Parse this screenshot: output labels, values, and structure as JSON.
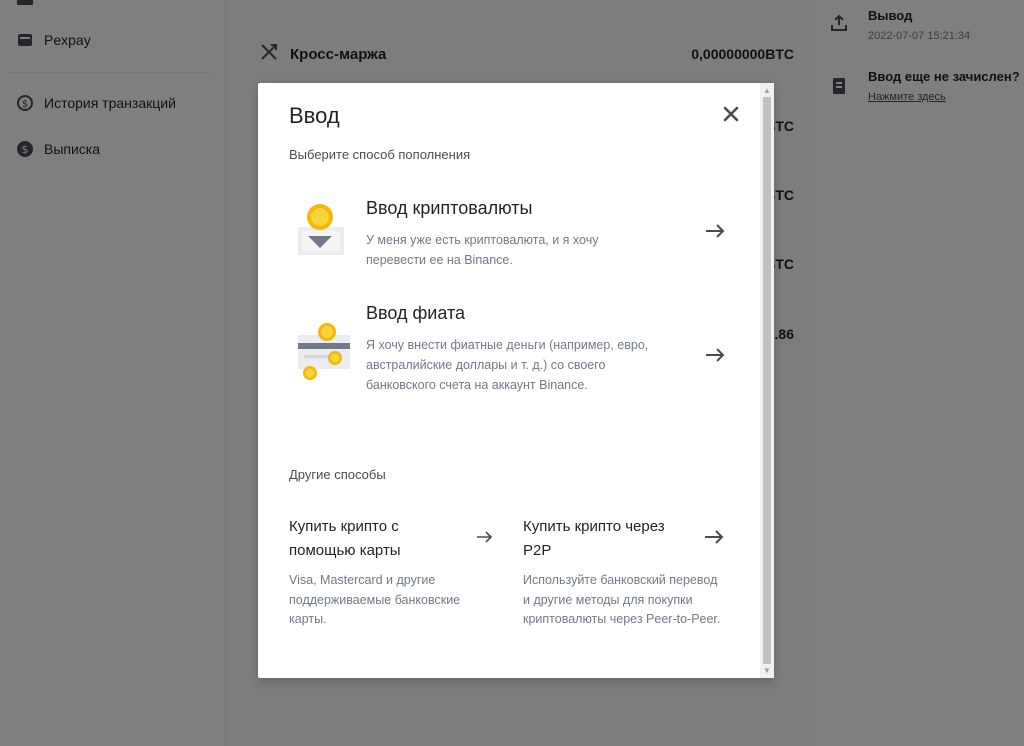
{
  "sidebar": {
    "items": [
      {
        "label": "Pexpay",
        "icon": "wallet-icon"
      },
      {
        "label": "История транзакций",
        "icon": "history-icon"
      },
      {
        "label": "Выписка",
        "icon": "dollar-circle-icon"
      }
    ]
  },
  "main": {
    "accounts": [
      {
        "name": "Кросс-маржа",
        "value": "0,00000000BTC"
      },
      {
        "value_fragment": "BTC"
      },
      {
        "value_fragment": "BTC"
      },
      {
        "value_fragment": "BTC"
      },
      {
        "value_fragment": ".86"
      }
    ]
  },
  "right_panel": {
    "withdraw_title": "Вывод",
    "withdraw_time": "2022-07-07 15:21:34",
    "not_credited_title": "Ввод еще не зачислен?",
    "not_credited_link": "Нажмите здесь"
  },
  "modal": {
    "title": "Ввод",
    "subtitle": "Выберите способ пополнения",
    "options": [
      {
        "title": "Ввод криптовалюты",
        "desc": "У меня уже есть криптовалюта, и я хочу перевести ее на Binance."
      },
      {
        "title": "Ввод фиата",
        "desc": "Я хочу внести фиатные деньги (например, евро, австралийские доллары и т. д.) со своего банковского счета на аккаунт Binance."
      }
    ],
    "other_label": "Другие способы",
    "other_methods": [
      {
        "title": "Купить крипто с помощью карты",
        "desc": "Visa, Mastercard и другие поддерживаемые банковские карты."
      },
      {
        "title": "Купить крипто через P2P",
        "desc": "Используйте банковский перевод и другие методы для покупки криптовалюты через Peer-to-Peer."
      }
    ]
  },
  "colors": {
    "accent_yellow": "#f0b90b",
    "text_primary": "#1e2329",
    "text_secondary": "#707a8a"
  }
}
